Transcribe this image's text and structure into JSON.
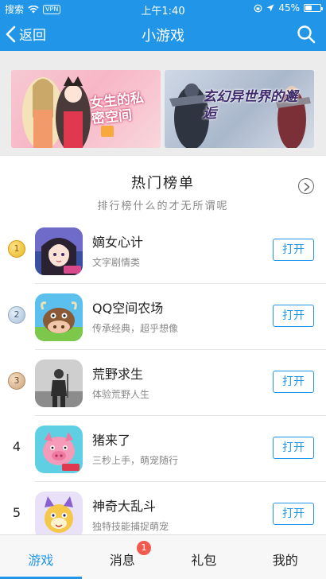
{
  "status_bar": {
    "carrier": "搜索",
    "vpn": "VPN",
    "time": "上午1:40",
    "battery": "45%"
  },
  "nav": {
    "back_label": "返回",
    "title": "小游戏"
  },
  "banners": [
    {
      "text": "女生的私密空间",
      "accent": "#f7b6c6"
    },
    {
      "text": "玄幻异世界的邂逅",
      "accent": "#aab8cc"
    }
  ],
  "section": {
    "title": "热门榜单",
    "subtitle": "排行榜什么的才无所谓呢"
  },
  "games": [
    {
      "rank": "1",
      "name": "嫡女心计",
      "desc": "文字剧情类",
      "button": "打开",
      "icon": "anime-girl-icon"
    },
    {
      "rank": "2",
      "name": "QQ空间农场",
      "desc": "传承经典，超乎想像",
      "button": "打开",
      "icon": "cow-farm-icon"
    },
    {
      "rank": "3",
      "name": "荒野求生",
      "desc": "体验荒野人生",
      "button": "打开",
      "icon": "survivor-icon"
    },
    {
      "rank": "4",
      "name": "猪来了",
      "desc": "三秒上手，萌宠随行",
      "button": "打开",
      "icon": "pig-icon"
    },
    {
      "rank": "5",
      "name": "神奇大乱斗",
      "desc": "独特技能捕捉萌宠",
      "button": "打开",
      "icon": "monster-icon"
    }
  ],
  "tabs": [
    {
      "label": "游戏",
      "active": true
    },
    {
      "label": "消息",
      "badge": "1"
    },
    {
      "label": "礼包"
    },
    {
      "label": "我的"
    }
  ],
  "colors": {
    "primary": "#2196e8",
    "badge": "#f15a4e"
  }
}
